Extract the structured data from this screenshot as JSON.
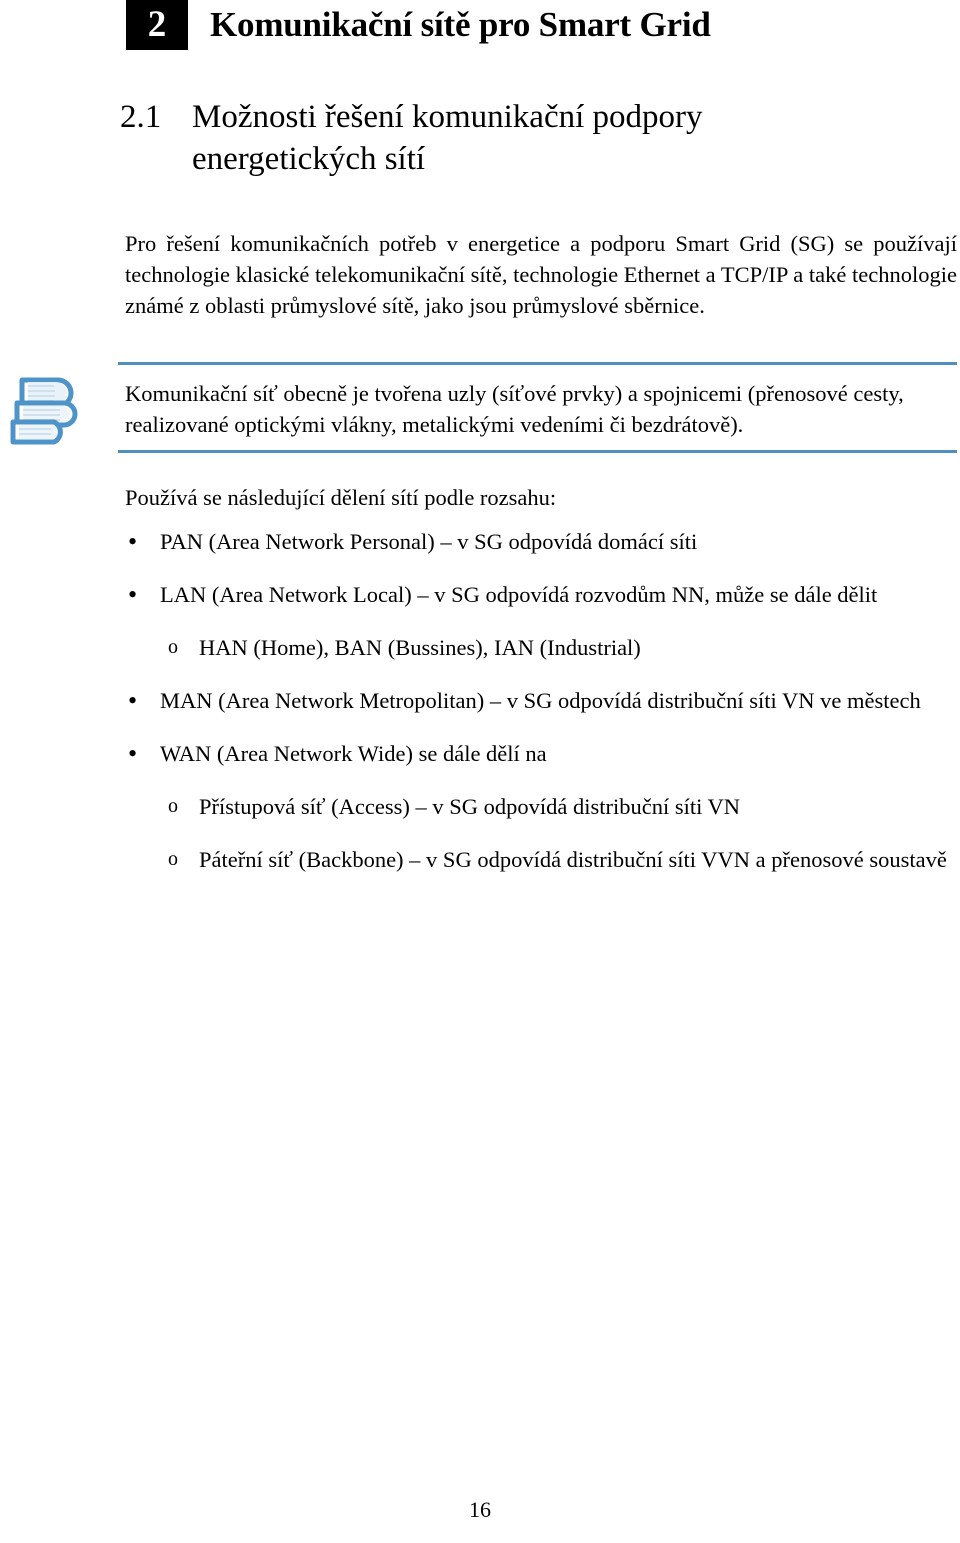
{
  "document": {
    "language": "cs",
    "page_number": "16"
  },
  "chapter": {
    "number": "2",
    "title": "Komunikační sítě pro Smart Grid"
  },
  "section": {
    "number": "2.1",
    "title": "Možnosti řešení komunikační podpory energetických sítí"
  },
  "paragraphs": {
    "intro": "Pro řešení komunikačních potřeb v energetice a podporu Smart Grid (SG) se používají technologie klasické telekomunikační sítě, technologie Ethernet a TCP/IP a také technologie známé z oblasti průmyslové sítě, jako jsou průmyslové sběrnice.",
    "list_intro": "Používá se následující dělení sítí podle rozsahu:"
  },
  "note": {
    "icon": "books-stack-icon",
    "accent_color": "#4f8fbf",
    "text": "Komunikační síť obecně je tvořena uzly (síťové prvky) a spojnicemi (přenosové cesty, realizované optickými vlákny, metalickými vedeními či bezdrátově)."
  },
  "list": {
    "bullet_marker": "•",
    "sub_marker": "o",
    "items": [
      {
        "level": 1,
        "marker": "•",
        "text": "PAN (Area Network Personal) – v SG odpovídá domácí síti",
        "justify": false
      },
      {
        "level": 1,
        "marker": "•",
        "text": "LAN (Area Network Local) – v SG odpovídá rozvodům NN, může se dále dělit",
        "justify": true
      },
      {
        "level": 2,
        "marker": "o",
        "text": "HAN (Home), BAN (Bussines), IAN (Industrial)",
        "justify": false
      },
      {
        "level": 1,
        "marker": "•",
        "text": "MAN (Area Network Metropolitan) – v SG odpovídá distribuční síti VN ve městech",
        "justify": true
      },
      {
        "level": 1,
        "marker": "•",
        "text": "WAN (Area Network Wide) se dále dělí na",
        "justify": false
      },
      {
        "level": 2,
        "marker": "o",
        "text": "Přístupová síť (Access) – v SG odpovídá distribuční síti VN",
        "justify": false
      },
      {
        "level": 2,
        "marker": "o",
        "text": "Páteřní síť (Backbone) – v SG odpovídá distribuční síti VVN a přenosové soustavě",
        "justify": true
      }
    ]
  }
}
